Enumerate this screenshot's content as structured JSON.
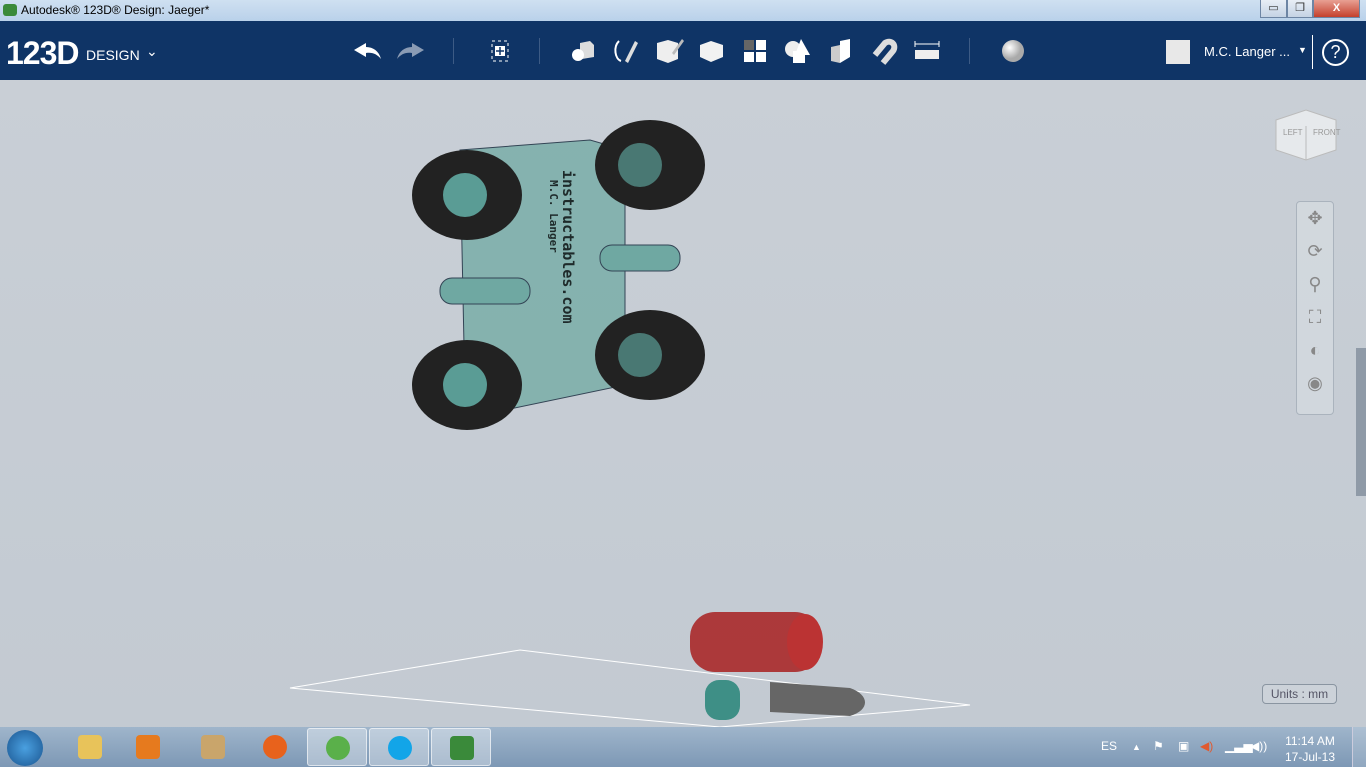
{
  "window": {
    "title": "Autodesk® 123D® Design: Jaeger*",
    "minimize": "▭",
    "restore": "❐",
    "close": "X"
  },
  "toolbar": {
    "logo": "123D",
    "logo_sub": "DESIGN",
    "logo_caret": "⌄",
    "tools": [
      {
        "name": "undo-icon"
      },
      {
        "name": "redo-icon"
      },
      {
        "name": "transform-icon"
      },
      {
        "name": "primitives-icon"
      },
      {
        "name": "sketch-icon"
      },
      {
        "name": "construct-icon"
      },
      {
        "name": "modify-icon"
      },
      {
        "name": "pattern-icon"
      },
      {
        "name": "grouping-icon"
      },
      {
        "name": "combine-icon"
      },
      {
        "name": "snap-icon"
      },
      {
        "name": "measure-icon"
      },
      {
        "name": "material-icon"
      }
    ],
    "user_name": "M.C. Langer ...",
    "user_caret": "▼",
    "help": "?"
  },
  "viewcube": {
    "left": "LEFT",
    "front": "FRONT"
  },
  "nav": [
    "pan-icon",
    "orbit-icon",
    "zoom-icon",
    "fit-icon",
    "view-mode-icon",
    "visibility-icon"
  ],
  "units": "Units : mm",
  "taskbar": {
    "apps": [
      "file-explorer",
      "media-player",
      "app-3",
      "firefox",
      "messenger",
      "skype",
      "123d-design"
    ],
    "lang": "ES",
    "time": "11:14 AM",
    "date": "17-Jul-13"
  },
  "model": {
    "text": "instructables.com",
    "text2": "M.C. Langer"
  }
}
